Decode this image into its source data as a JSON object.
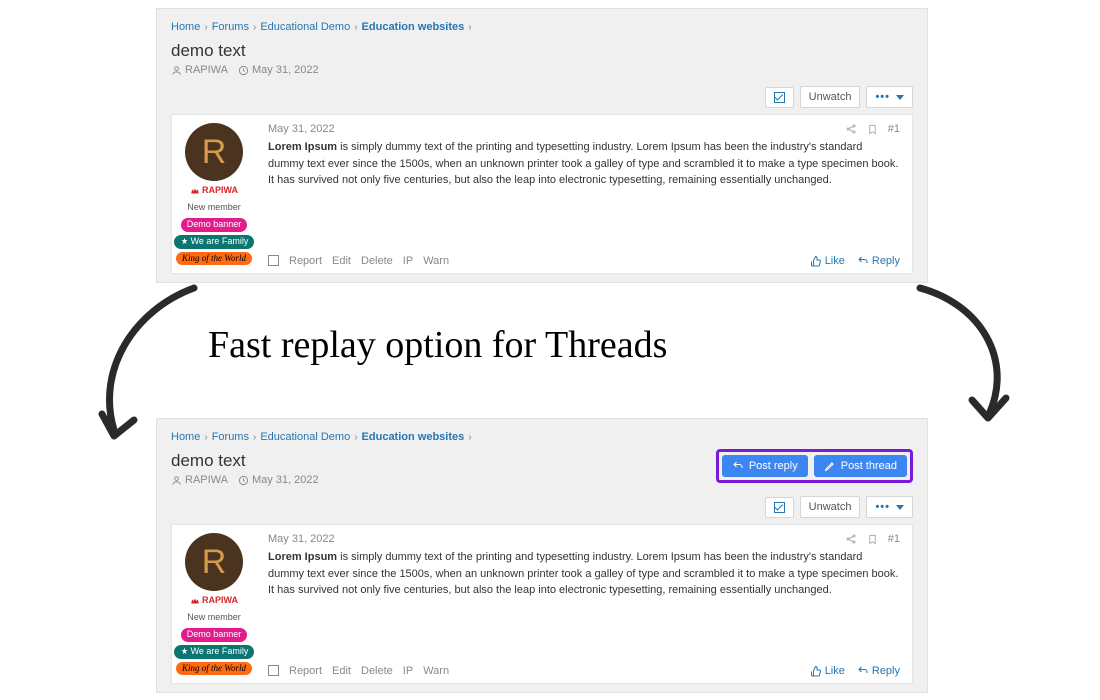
{
  "headline": "Fast replay option for Threads",
  "breadcrumbs": [
    {
      "label": "Home",
      "active": false
    },
    {
      "label": "Forums",
      "active": false
    },
    {
      "label": "Educational Demo",
      "active": false
    },
    {
      "label": "Education websites",
      "active": true
    }
  ],
  "thread": {
    "title": "demo text",
    "author": "RAPIWA",
    "date": "May 31, 2022"
  },
  "toolbar": {
    "unwatch": "Unwatch"
  },
  "cta": {
    "post_reply": "Post reply",
    "post_thread": "Post thread"
  },
  "user": {
    "avatar_letter": "R",
    "name": "RAPIWA",
    "role": "New member",
    "badges": {
      "demo": "Demo banner",
      "family": "We are Family",
      "king": "King of the World"
    }
  },
  "post": {
    "date": "May 31, 2022",
    "number": "#1",
    "lead": "Lorem Ipsum",
    "body": " is simply dummy text of the printing and typesetting industry. Lorem Ipsum has been the industry's standard dummy text ever since the 1500s, when an unknown printer took a galley of type and scrambled it to make a type specimen book. It has survived not only five centuries, but also the leap into electronic typesetting, remaining essentially unchanged."
  },
  "mod": {
    "report": "Report",
    "edit": "Edit",
    "delete": "Delete",
    "ip": "IP",
    "warn": "Warn"
  },
  "react": {
    "like": "Like",
    "reply": "Reply"
  }
}
